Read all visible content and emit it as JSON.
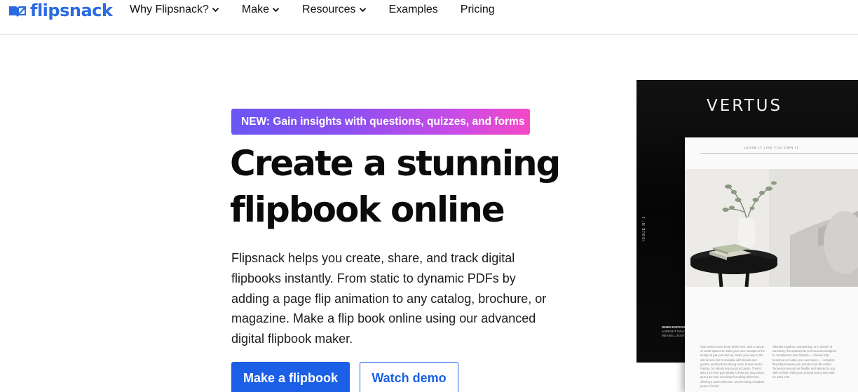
{
  "header": {
    "logo_text": "flipsnack",
    "nav": [
      {
        "label": "Why Flipsnack?",
        "has_dropdown": true
      },
      {
        "label": "Make",
        "has_dropdown": true
      },
      {
        "label": "Resources",
        "has_dropdown": true
      },
      {
        "label": "Examples",
        "has_dropdown": false
      },
      {
        "label": "Pricing",
        "has_dropdown": false
      }
    ]
  },
  "hero": {
    "badge": "NEW: Gain insights with questions, quizzes, and forms",
    "headline_line1": "Create a stunning",
    "headline_line2": "flipbook online",
    "description": "Flipsnack helps you create, share, and track digital flipbooks instantly. From static to dynamic PDFs by adding a page flip animation to any catalog, brochure, or magazine. Make a flip book online using our advanced digital flipbook maker.",
    "primary_cta": "Make a flipbook",
    "secondary_cta": "Watch demo"
  },
  "magazine": {
    "title": "VERTUS",
    "issue": "ISSUE N° 1",
    "cover_caption_head": "WHEN EXPERIEN",
    "cover_caption_line1": "A BRIGHT NEW",
    "cover_caption_line2": "MEANS LUXURY IS",
    "page_kicker": "LEASE IT LIKE YOU OWN IT",
    "col1_text": "Club Vertus is the heart of life here, with a variety of social spaces to make your own. Escape to the lounge to put your feet up, make your way to the self service bar to socialise with friends and guests, and book the dining room, known as the Parlour, for almost any social occasion. There's also a 24-hour gym studio to help you stay active, plus a 24-hour concierge for taking deliveries, offering a warm welcome, and ensuring complete peace of mind.",
    "col2_text": "Whether together, entertaining, or in search of sanctuary, the apartments at Vertus are designed to complement your lifestyle — choose fully furnished or curate your own space — complete flexibility however you decide to let life unfold. Tenancies are just as flexible and tailored to you, with no fees, letting you unwind at any time with no extra cost."
  },
  "colors": {
    "brand_blue": "#1a5fe6",
    "logo_blue": "#2a6be3",
    "badge_gradient_start": "#6a56f5",
    "badge_gradient_end": "#f448c6"
  },
  "icons": {
    "logo": "flipsnack-book-icon",
    "dropdown": "chevron-down-icon"
  }
}
